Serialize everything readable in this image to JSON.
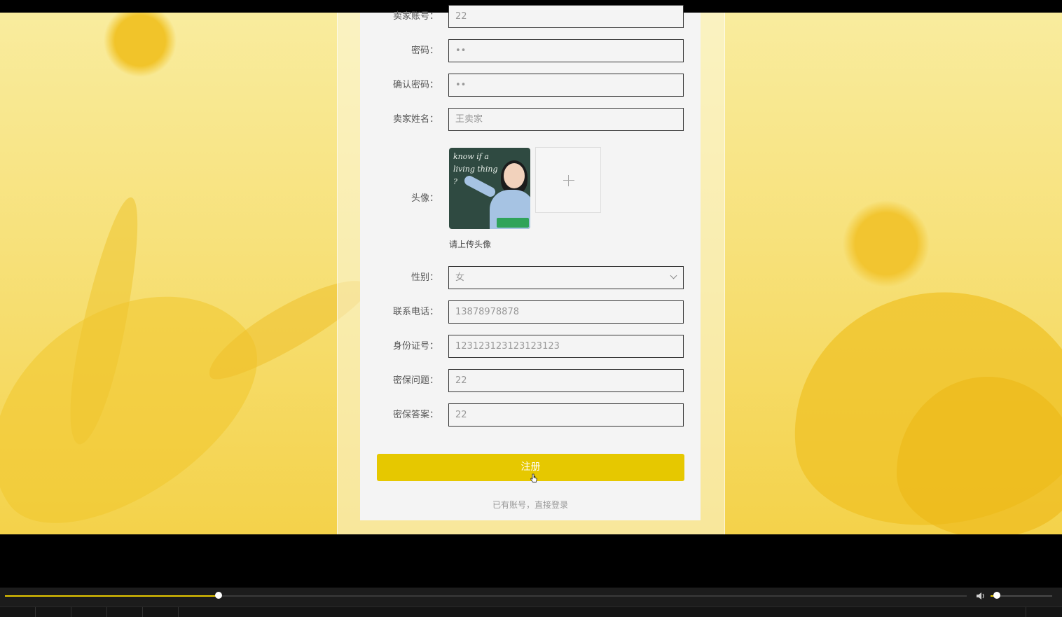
{
  "form": {
    "account": {
      "label": "卖家账号：",
      "value": "22"
    },
    "password": {
      "label": "密码：",
      "value": "••"
    },
    "confirm_password": {
      "label": "确认密码：",
      "value": "••"
    },
    "name": {
      "label": "卖家姓名：",
      "value": "王卖家"
    },
    "avatar": {
      "label": "头像：",
      "hint": "请上传头像",
      "board_text": "know if a living thing ?"
    },
    "gender": {
      "label": "性别：",
      "value": "女"
    },
    "phone": {
      "label": "联系电话：",
      "value": "13878978878"
    },
    "id_number": {
      "label": "身份证号：",
      "value": "123123123123123123"
    },
    "security_question": {
      "label": "密保问题：",
      "value": "22"
    },
    "security_answer": {
      "label": "密保答案：",
      "value": "22"
    },
    "submit_label": "注册",
    "login_link": "已有账号，直接登录"
  },
  "player": {
    "progress_fraction": 0.222,
    "volume_fraction": 0.1
  },
  "colors": {
    "accent": "#e6c800",
    "card_bg": "#f4f4f4",
    "background_yellow": "#f7e17a"
  }
}
